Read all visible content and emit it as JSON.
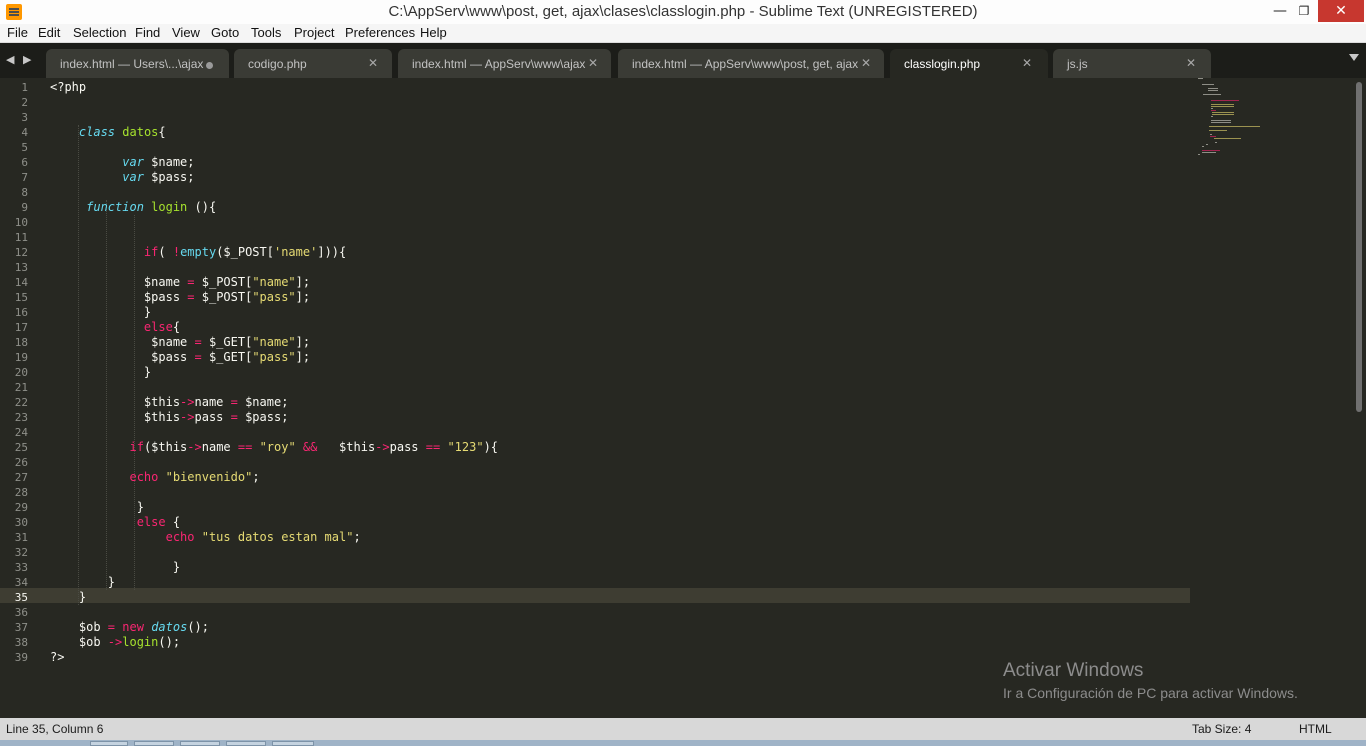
{
  "window": {
    "title": "C:\\AppServ\\www\\post, get, ajax\\clases\\classlogin.php - Sublime Text (UNREGISTERED)",
    "minimize_glyph": "—",
    "maximize_glyph": "❐",
    "close_glyph": "✕"
  },
  "menu": {
    "items": [
      "File",
      "Edit",
      "Selection",
      "Find",
      "View",
      "Goto",
      "Tools",
      "Project",
      "Preferences",
      "Help"
    ]
  },
  "tabbar": {
    "prev_glyph": "◀",
    "next_glyph": "▶",
    "close_glyph": "✕",
    "tabs": [
      {
        "label": "index.html — Users\\...\\ajax",
        "modified": true,
        "active": false
      },
      {
        "label": "codigo.php",
        "modified": false,
        "active": false
      },
      {
        "label": "index.html — AppServ\\www\\ajax",
        "modified": false,
        "active": false
      },
      {
        "label": "index.html — AppServ\\www\\post, get, ajax",
        "modified": false,
        "active": false
      },
      {
        "label": "classlogin.php",
        "modified": false,
        "active": true
      },
      {
        "label": "js.js",
        "modified": false,
        "active": false
      }
    ]
  },
  "editor": {
    "current_line": 35,
    "line_numbers": [
      "1",
      "2",
      "3",
      "4",
      "5",
      "6",
      "7",
      "8",
      "9",
      "10",
      "11",
      "12",
      "13",
      "14",
      "15",
      "16",
      "17",
      "18",
      "19",
      "20",
      "21",
      "22",
      "23",
      "24",
      "25",
      "26",
      "27",
      "28",
      "29",
      "30",
      "31",
      "32",
      "33",
      "34",
      "35",
      "36",
      "37",
      "38",
      "39"
    ],
    "lines": [
      "<?php",
      "",
      "",
      "    class datos{",
      "",
      "          var $name;",
      "          var $pass;",
      "",
      "     function login (){",
      "",
      "",
      "             if( !empty($_POST['name'])){",
      "",
      "             $name = $_POST[\"name\"];",
      "             $pass = $_POST[\"pass\"];",
      "             }",
      "             else{",
      "              $name = $_GET[\"name\"];",
      "              $pass = $_GET[\"pass\"];",
      "             }",
      "",
      "             $this->name = $name;",
      "             $this->pass = $pass;",
      "",
      "           if($this->name == \"roy\" &&   $this->pass == \"123\"){",
      "",
      "           echo \"bienvenido\";",
      "",
      "            }",
      "            else {",
      "                echo \"tus datos estan mal\";",
      "",
      "                 }",
      "        }",
      "    }",
      "",
      "    $ob = new datos();",
      "    $ob ->login();",
      "?>"
    ]
  },
  "watermark": {
    "title": "Activar Windows",
    "subtitle": "Ir a Configuración de PC para activar Windows."
  },
  "status": {
    "position": "Line 35, Column 6",
    "tab_size": "Tab Size: 4",
    "syntax": "HTML"
  }
}
